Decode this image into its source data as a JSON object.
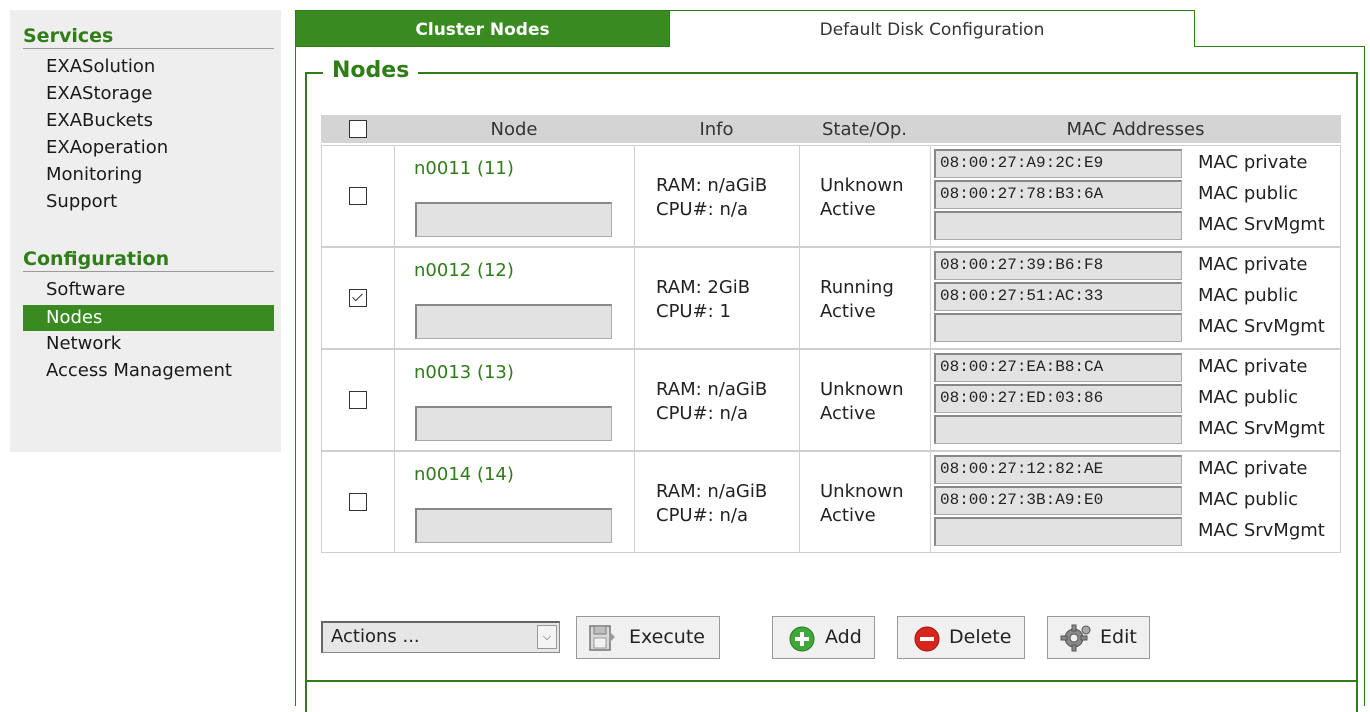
{
  "sidebar": {
    "services_heading": "Services",
    "services_items": [
      "EXASolution",
      "EXAStorage",
      "EXABuckets",
      "EXAoperation",
      "Monitoring",
      "Support"
    ],
    "configuration_heading": "Configuration",
    "configuration_items": [
      "Software",
      "Nodes",
      "Network",
      "Access Management"
    ],
    "active_item": "Nodes"
  },
  "tabs": {
    "cluster_nodes": "Cluster Nodes",
    "default_disk": "Default Disk Configuration"
  },
  "section_title": "Nodes",
  "table": {
    "headers": {
      "node": "Node",
      "info": "Info",
      "state": "State/Op.",
      "mac": "MAC Addresses"
    },
    "mac_labels": [
      "MAC private",
      "MAC public",
      "MAC SrvMgmt"
    ],
    "rows": [
      {
        "name": "n0011 (11)",
        "checked": false,
        "ram": "RAM: n/aGiB",
        "cpu": "CPU#: n/a",
        "state": "Unknown",
        "op": "Active",
        "macs": [
          "08:00:27:A9:2C:E9",
          "08:00:27:78:B3:6A",
          ""
        ]
      },
      {
        "name": "n0012 (12)",
        "checked": true,
        "ram": "RAM: 2GiB",
        "cpu": "CPU#: 1",
        "state": "Running",
        "op": "Active",
        "macs": [
          "08:00:27:39:B6:F8",
          "08:00:27:51:AC:33",
          ""
        ]
      },
      {
        "name": "n0013 (13)",
        "checked": false,
        "ram": "RAM: n/aGiB",
        "cpu": "CPU#: n/a",
        "state": "Unknown",
        "op": "Active",
        "macs": [
          "08:00:27:EA:B8:CA",
          "08:00:27:ED:03:86",
          ""
        ]
      },
      {
        "name": "n0014 (14)",
        "checked": false,
        "ram": "RAM: n/aGiB",
        "cpu": "CPU#: n/a",
        "state": "Unknown",
        "op": "Active",
        "macs": [
          "08:00:27:12:82:AE",
          "08:00:27:3B:A9:E0",
          ""
        ]
      }
    ]
  },
  "controls": {
    "actions_value": "Actions ...",
    "execute": "Execute",
    "add": "Add",
    "delete": "Delete",
    "edit": "Edit"
  },
  "colors": {
    "brand_green": "#3a8a22",
    "link_green": "#2e7d17"
  }
}
